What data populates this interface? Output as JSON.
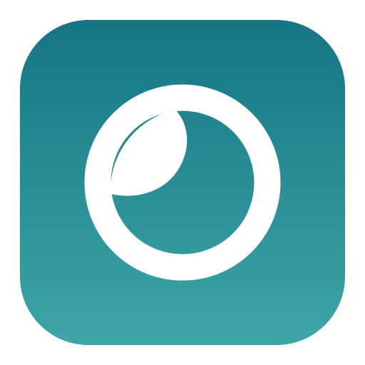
{
  "icon": {
    "name": "app-icon",
    "glyph": "crescent-ring-icon",
    "colors": {
      "gradient_top": "#167585",
      "gradient_bottom": "#3DA6A8",
      "glyph": "#FFFFFF"
    }
  }
}
